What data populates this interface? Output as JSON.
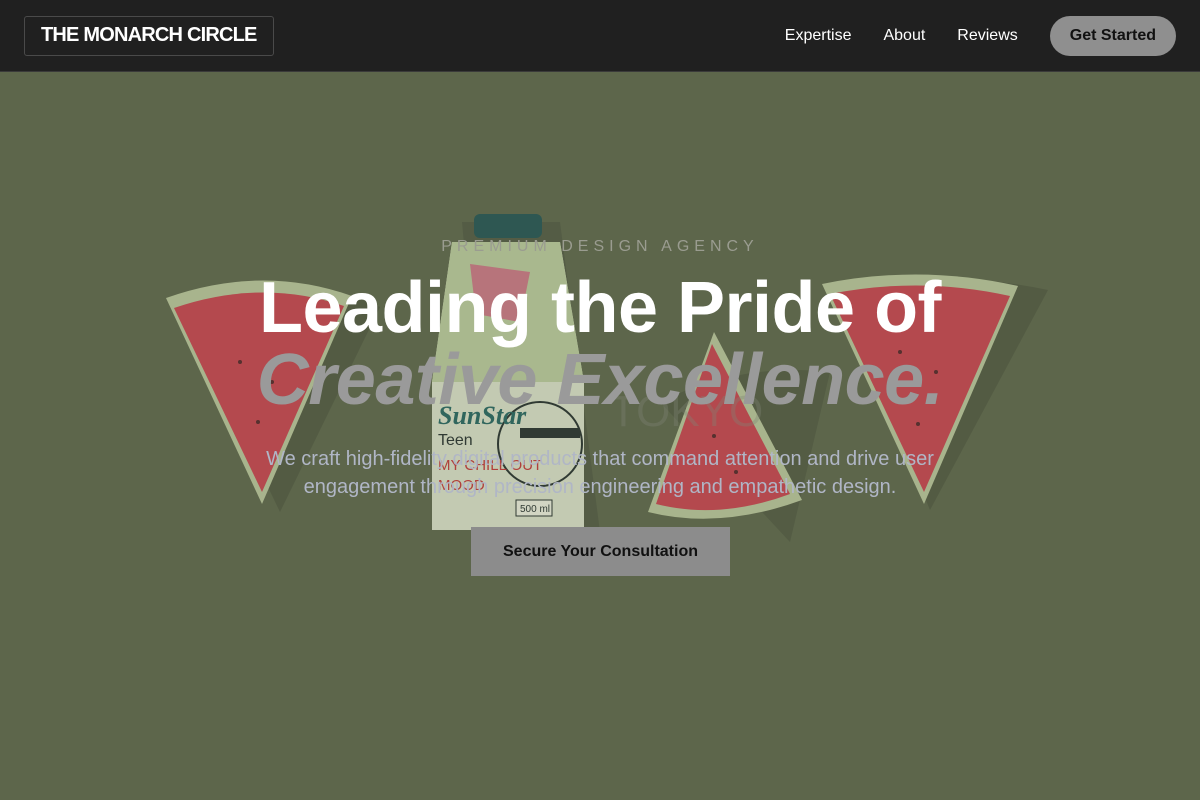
{
  "header": {
    "logo": "THE MONARCH CIRCLE",
    "nav": [
      {
        "label": "Expertise"
      },
      {
        "label": "About"
      },
      {
        "label": "Reviews"
      }
    ],
    "cta_label": "Get Started"
  },
  "hero": {
    "eyebrow": "PREMIUM DESIGN AGENCY",
    "headline_line1": "Leading the Pride of",
    "headline_line2": "Creative Excellence.",
    "subtext": "We craft high-fidelity digital products that command attention and drive user engagement through precision engineering and empathetic design.",
    "button_label": "Secure Your Consultation",
    "background_image": {
      "carton_label_brand": "SunStar",
      "carton_label_sub": "Teen",
      "carton_label_flavor": "MY CHILL OUT MOOD",
      "carton_volume": "500 ml"
    }
  },
  "colors": {
    "nav_bg": "#202020",
    "hero_bg": "#626b4f",
    "headline": "#ffffff",
    "headline_accent": "#9a9a9a",
    "button_bg": "#8c8c8c",
    "watermelon_flesh": "#c44a50",
    "watermelon_rind": "#c9d4a6"
  }
}
